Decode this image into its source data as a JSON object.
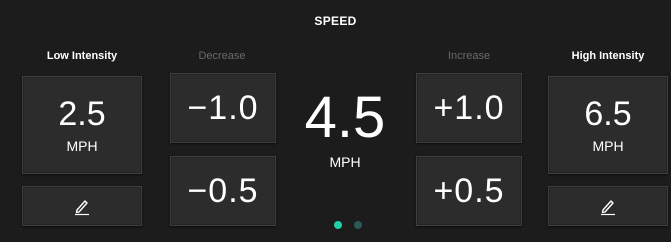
{
  "title": "SPEED",
  "low": {
    "header": "Low Intensity",
    "value": "2.5",
    "unit": "MPH"
  },
  "decrease": {
    "header": "Decrease",
    "step1": "−1.0",
    "step2": "−0.5"
  },
  "current": {
    "value": "4.5",
    "unit": "MPH"
  },
  "increase": {
    "header": "Increase",
    "step1": "+1.0",
    "step2": "+0.5"
  },
  "high": {
    "header": "High Intensity",
    "value": "6.5",
    "unit": "MPH"
  },
  "icons": {
    "edit": "pencil-icon"
  },
  "pager": {
    "pages": 2,
    "active": 1
  },
  "colors": {
    "background": "#1c1c1c",
    "tile": "#2c2c2c",
    "active_dot": "#1fd0a8",
    "inactive_dot": "#2a5a56",
    "dim_text": "#6a6a6a"
  }
}
